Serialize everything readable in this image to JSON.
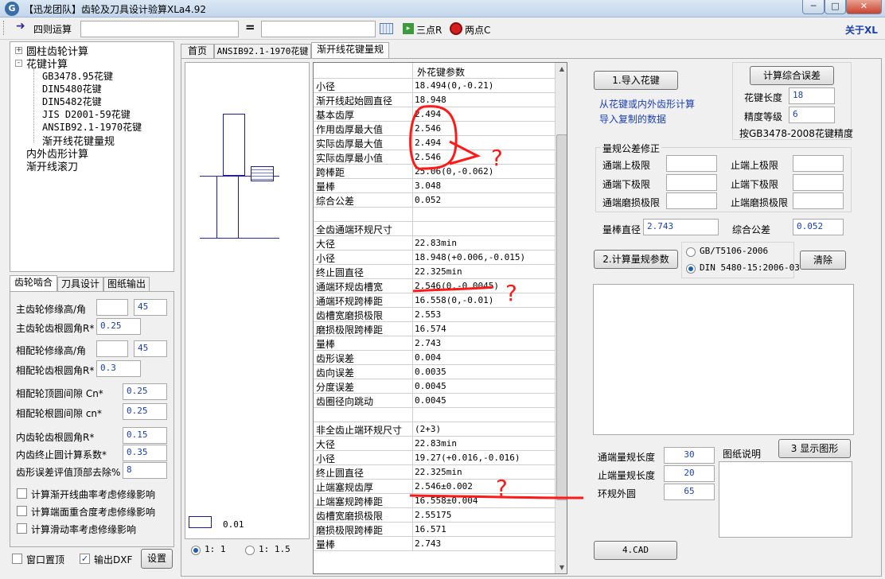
{
  "window": {
    "title": "【迅龙团队】齿轮及刀具设计验算XLa4.92",
    "minimize": "─",
    "maximize": "□",
    "close": "✕"
  },
  "toolbar": {
    "calc_label": "四则运算",
    "equals": "=",
    "three_point": "三点R",
    "two_point": "两点C",
    "about": "关于XL"
  },
  "tree": {
    "items": [
      {
        "label": "圆柱齿轮计算",
        "toggle": "+"
      },
      {
        "label": "花键计算",
        "toggle": "-"
      },
      {
        "label": "GB3478.95花键"
      },
      {
        "label": "DIN5480花键"
      },
      {
        "label": "DIN5482花键"
      },
      {
        "label": "JIS D2001-59花键"
      },
      {
        "label": "ANSIB92.1-1970花键"
      },
      {
        "label": "渐开线花键量规"
      },
      {
        "label": "内外齿形计算"
      },
      {
        "label": "渐开线滚刀"
      }
    ]
  },
  "left_tabs": [
    "齿轮啮合",
    "刀具设计",
    "图纸输出"
  ],
  "params": {
    "main_tip_mod": {
      "label": "主齿轮修缘高/角",
      "v1": "",
      "v2": "45"
    },
    "main_root_r": {
      "label": "主齿轮齿根圆角R*",
      "v": "0.25"
    },
    "mate_tip_mod": {
      "label": "相配轮修缘高/角",
      "v1": "",
      "v2": "45"
    },
    "mate_root_r": {
      "label": "相配轮齿根圆角R*",
      "v": "0.3"
    },
    "tip_clear": {
      "label": "相配轮顶圆间隙  Cn*",
      "v": "0.25"
    },
    "root_clear": {
      "label": "相配轮根圆间隙  cn*",
      "v": "0.25"
    },
    "int_root_r": {
      "label": "内齿轮齿根圆角R*",
      "v": "0.15"
    },
    "int_end_coef": {
      "label": "内齿终止圆计算系数*",
      "v": "0.35"
    },
    "err_removal": {
      "label": "齿形误差评值顶部去除%",
      "v": "8"
    }
  },
  "checks": [
    {
      "label": "计算渐开线曲率考虑修缘影响",
      "checked": false
    },
    {
      "label": "计算端面重合度考虑修缘影响",
      "checked": false
    },
    {
      "label": "计算滑动率考虑修缘影响",
      "checked": false
    }
  ],
  "bottom": {
    "window_top": "窗口置顶",
    "export_dxf": "输出DXF",
    "export_checked": "✓",
    "settings": "设置"
  },
  "main_tabs": [
    "首页",
    "ANSIB92.1-1970花键",
    "渐开线花键量规"
  ],
  "preview": {
    "scale_value": "0.01",
    "ratio_1": "1: 1",
    "ratio_2": "1: 1.5"
  },
  "grid": {
    "header": "外花键参数",
    "rows": [
      {
        "k": "小径",
        "v": "18.494(0,-0.21)"
      },
      {
        "k": "渐开线起始圆直径",
        "v": "18.948"
      },
      {
        "k": "基本齿厚",
        "v": "2.494"
      },
      {
        "k": "作用齿厚最大值",
        "v": "2.546"
      },
      {
        "k": "实际齿厚最大值",
        "v": "2.494"
      },
      {
        "k": "实际齿厚最小值",
        "v": "2.546"
      },
      {
        "k": "跨棒距",
        "v": "25.06(0,-0.062)"
      },
      {
        "k": "量棒",
        "v": "3.048"
      },
      {
        "k": "综合公差",
        "v": "0.052"
      },
      {
        "k": "",
        "v": ""
      },
      {
        "k": "全齿通端环规尺寸",
        "v": ""
      },
      {
        "k": "大径",
        "v": "22.83min"
      },
      {
        "k": "小径",
        "v": "18.948(+0.006,-0.015)"
      },
      {
        "k": "终止圆直径",
        "v": "22.325min"
      },
      {
        "k": "通端环规齿槽宽",
        "v": "2.546(0,-0.0045)"
      },
      {
        "k": "通端环规跨棒距",
        "v": "16.558(0,-0.01)"
      },
      {
        "k": "齿槽宽磨损极限",
        "v": "2.553"
      },
      {
        "k": "磨损极限跨棒距",
        "v": "16.574"
      },
      {
        "k": "量棒",
        "v": "2.743"
      },
      {
        "k": "齿形误差",
        "v": "0.004"
      },
      {
        "k": "齿向误差",
        "v": "0.0035"
      },
      {
        "k": "分度误差",
        "v": "0.0045"
      },
      {
        "k": "齿圈径向跳动",
        "v": "0.0045"
      },
      {
        "k": "",
        "v": ""
      },
      {
        "k": "非全齿止端环规尺寸",
        "v": "(2+3)"
      },
      {
        "k": "大径",
        "v": "22.83min"
      },
      {
        "k": "小径",
        "v": "19.27(+0.016,-0.016)"
      },
      {
        "k": "终止圆直径",
        "v": "22.325min"
      },
      {
        "k": "止端塞规齿厚",
        "v": "2.546±0.002"
      },
      {
        "k": "止端塞规跨棒距",
        "v": "16.558±0.004"
      },
      {
        "k": "齿槽宽磨损极限",
        "v": "2.55175"
      },
      {
        "k": "磨损极限跨棒距",
        "v": "16.571"
      },
      {
        "k": "量棒",
        "v": "2.743"
      }
    ]
  },
  "annotations": {
    "q1": "?",
    "q2": "?",
    "q3": "?"
  },
  "right": {
    "import_btn": "1.导入花键",
    "import_hint1": "从花键或内外齿形计算",
    "import_hint2": "导入复制的数据",
    "calc_err_btn": "计算综合误差",
    "spline_len_label": "花键长度",
    "spline_len": "18",
    "grade_label": "精度等级",
    "grade": "6",
    "grade_note": "按GB3478-2008花键精度",
    "tol_group": "量规公差修正",
    "go_upper": "通端上极限",
    "go_lower": "通端下极限",
    "go_wear": "通端磨损极限",
    "nogo_upper": "止端上极限",
    "nogo_lower": "止端下极限",
    "nogo_wear": "止端磨损极限",
    "pin_dia_label": "量棒直径",
    "pin_dia": "2.743",
    "total_tol_label": "综合公差",
    "total_tol": "0.052",
    "calc_gauge_btn": "2.计算量规参数",
    "std1": "GB/T5106-2006",
    "std2": "DIN 5480-15:2006-03",
    "clear_btn": "清除",
    "go_len_label": "通端量规长度",
    "go_len": "30",
    "nogo_len_label": "止端量规长度",
    "nogo_len": "20",
    "ring_od_label": "环规外圆",
    "ring_od": "65",
    "drawing_note": "图纸说明",
    "show_fig_btn": "3 显示图形",
    "cad_btn": "4.CAD"
  },
  "colors": {
    "accent_blue": "#1a3fb0",
    "annotation_red": "#ff1a1a"
  }
}
